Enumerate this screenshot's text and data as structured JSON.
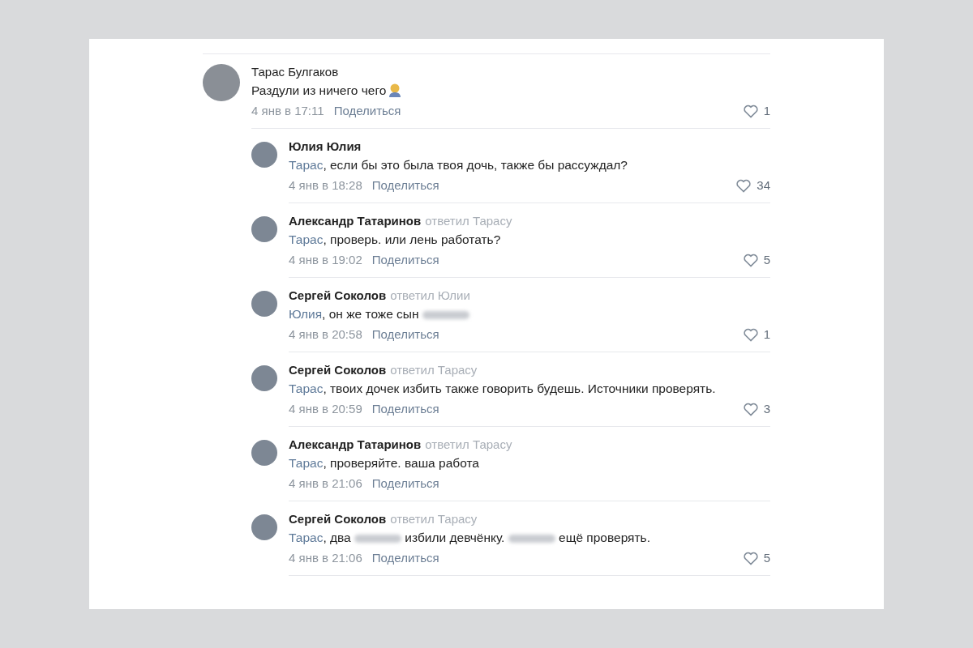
{
  "comments": [
    {
      "author": "Тарас Булгаков",
      "body": [
        {
          "kind": "text",
          "text": "Раздули из ничего чего"
        },
        {
          "kind": "emoji"
        }
      ],
      "date": "4 янв в 17:11",
      "share": "Поделиться",
      "likes": "1",
      "replies": [
        {
          "author": "Юлия Юлия",
          "body": [
            {
              "kind": "mention",
              "text": "Тарас"
            },
            {
              "kind": "text",
              "text": ", если бы это была твоя дочь, также бы рассуждал?"
            }
          ],
          "date": "4 янв в 18:28",
          "share": "Поделиться",
          "likes": "34"
        },
        {
          "author": "Александр Татаринов",
          "replied_to": "ответил Тарасу",
          "body": [
            {
              "kind": "mention",
              "text": "Тарас"
            },
            {
              "kind": "text",
              "text": ", проверь. или лень работать?"
            }
          ],
          "date": "4 янв в 19:02",
          "share": "Поделиться",
          "likes": "5"
        },
        {
          "author": "Сергей Соколов",
          "replied_to": "ответил Юлии",
          "body": [
            {
              "kind": "mention",
              "text": "Юлия"
            },
            {
              "kind": "text",
              "text": ", он же тоже сын"
            },
            {
              "kind": "redacted"
            }
          ],
          "date": "4 янв в 20:58",
          "share": "Поделиться",
          "likes": "1"
        },
        {
          "author": "Сергей Соколов",
          "replied_to": "ответил Тарасу",
          "body": [
            {
              "kind": "mention",
              "text": "Тарас"
            },
            {
              "kind": "text",
              "text": ", твоих дочек избить также говорить будешь. Источники проверять."
            }
          ],
          "date": "4 янв в 20:59",
          "share": "Поделиться",
          "likes": "3"
        },
        {
          "author": "Александр Татаринов",
          "replied_to": "ответил Тарасу",
          "body": [
            {
              "kind": "mention",
              "text": "Тарас"
            },
            {
              "kind": "text",
              "text": ", проверяйте. ваша работа"
            }
          ],
          "date": "4 янв в 21:06",
          "share": "Поделиться"
        },
        {
          "author": "Сергей Соколов",
          "replied_to": "ответил Тарасу",
          "body": [
            {
              "kind": "mention",
              "text": "Тарас"
            },
            {
              "kind": "text",
              "text": ", два"
            },
            {
              "kind": "redacted"
            },
            {
              "kind": "text",
              "text": "избили девчёнку."
            },
            {
              "kind": "redacted"
            },
            {
              "kind": "text",
              "text": "ещё проверять."
            }
          ],
          "date": "4 янв в 21:06",
          "share": "Поделиться",
          "likes": "5"
        }
      ]
    }
  ]
}
